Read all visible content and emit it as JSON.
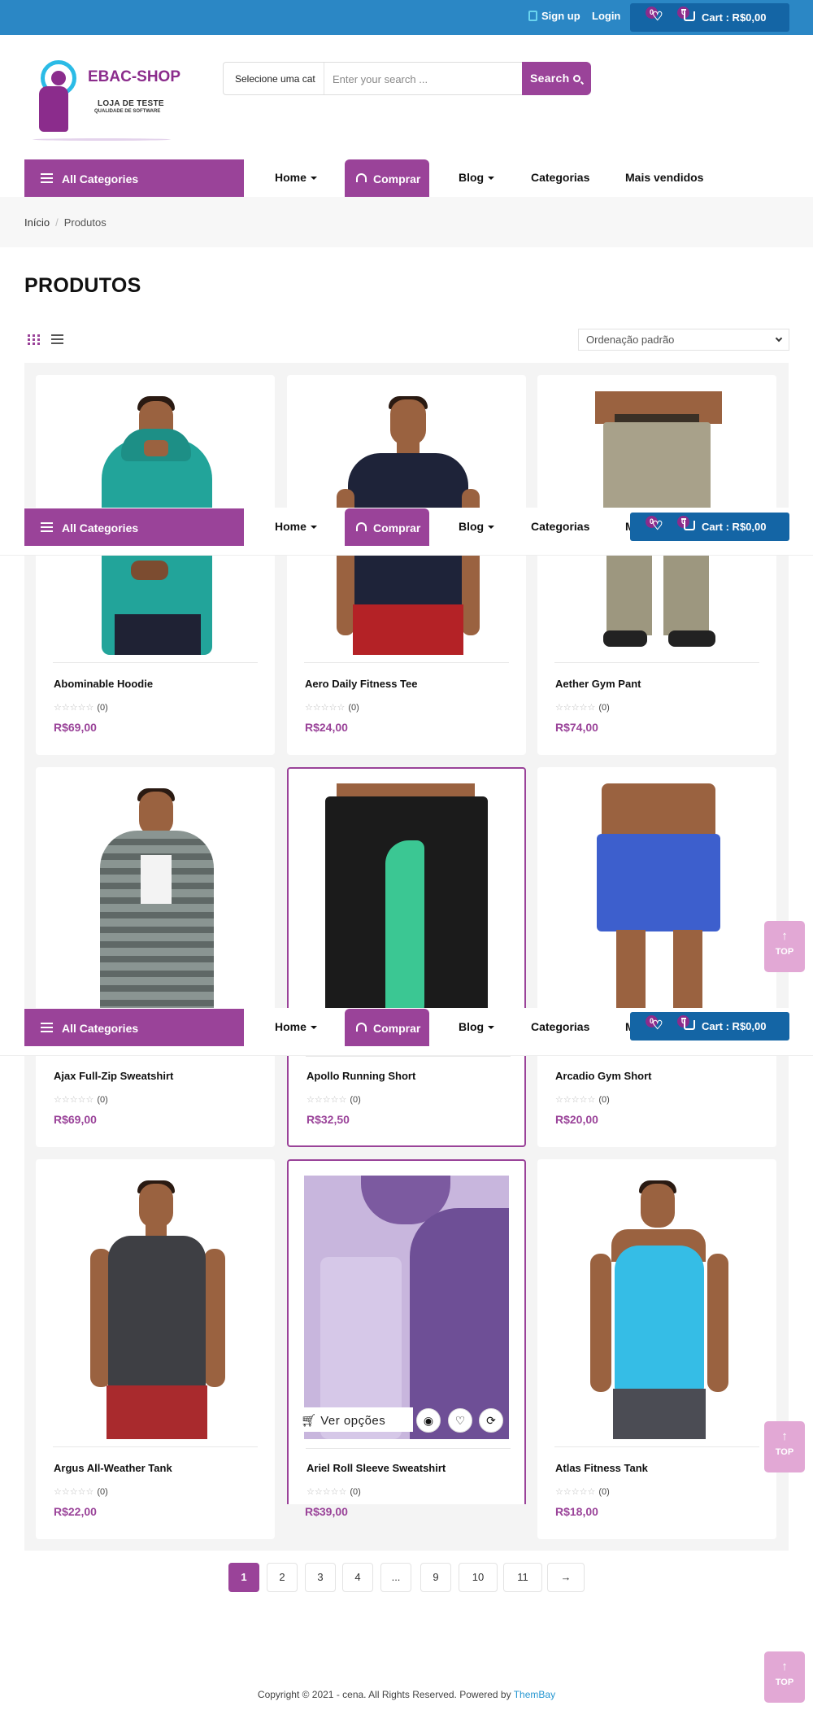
{
  "topbar": {
    "signup": "Sign up",
    "login": "Login",
    "wishlist_count": "0",
    "cart_count": "0",
    "cart_label": "Cart : R$0,00"
  },
  "logo": {
    "title": "EBAC-SHOP",
    "subtitle": "LOJA DE TESTE",
    "tagline": "QUALIDADE DE SOFTWARE"
  },
  "search": {
    "category": "Selecione uma cat",
    "placeholder": "Enter your search ...",
    "button": "Search"
  },
  "nav": {
    "all_categories": "All Categories",
    "home": "Home",
    "comprar": "Comprar",
    "blog": "Blog",
    "categorias": "Categorias",
    "mais_vendidos": "Mais vendidos",
    "truncated": "M"
  },
  "breadcrumb": {
    "home": "Início",
    "current": "Produtos"
  },
  "page_title": "PRODUTOS",
  "sort": {
    "selected": "Ordenação padrão"
  },
  "products": [
    {
      "name": "Abominable Hoodie",
      "reviews": "(0)",
      "price": "R$69,00"
    },
    {
      "name": "Aero Daily Fitness Tee",
      "reviews": "(0)",
      "price": "R$24,00"
    },
    {
      "name": "Aether Gym Pant",
      "reviews": "(0)",
      "price": "R$74,00"
    },
    {
      "name": "Ajax Full-Zip Sweatshirt",
      "reviews": "(0)",
      "price": "R$69,00"
    },
    {
      "name": "Apollo Running Short",
      "reviews": "(0)",
      "price": "R$32,50"
    },
    {
      "name": "Arcadio Gym Short",
      "reviews": "(0)",
      "price": "R$20,00"
    },
    {
      "name": "Argus All-Weather Tank",
      "reviews": "(0)",
      "price": "R$22,00"
    },
    {
      "name": "Ariel Roll Sleeve Sweatshirt",
      "reviews": "(0)",
      "price": "R$39,00"
    },
    {
      "name": "Atlas Fitness Tank",
      "reviews": "(0)",
      "price": "R$18,00"
    }
  ],
  "hover": {
    "ver_opcoes": "Ver opções"
  },
  "pagination": [
    "1",
    "2",
    "3",
    "4",
    "...",
    "9",
    "10",
    "11",
    "→"
  ],
  "top_button": "TOP",
  "footer": {
    "text": "Copyright © 2021 - cena. All Rights Reserved. Powered by ",
    "link": "ThemBay"
  },
  "colors": {
    "topbar": "#2b87c5",
    "accent": "#9a4399",
    "cart": "#1465a5"
  }
}
